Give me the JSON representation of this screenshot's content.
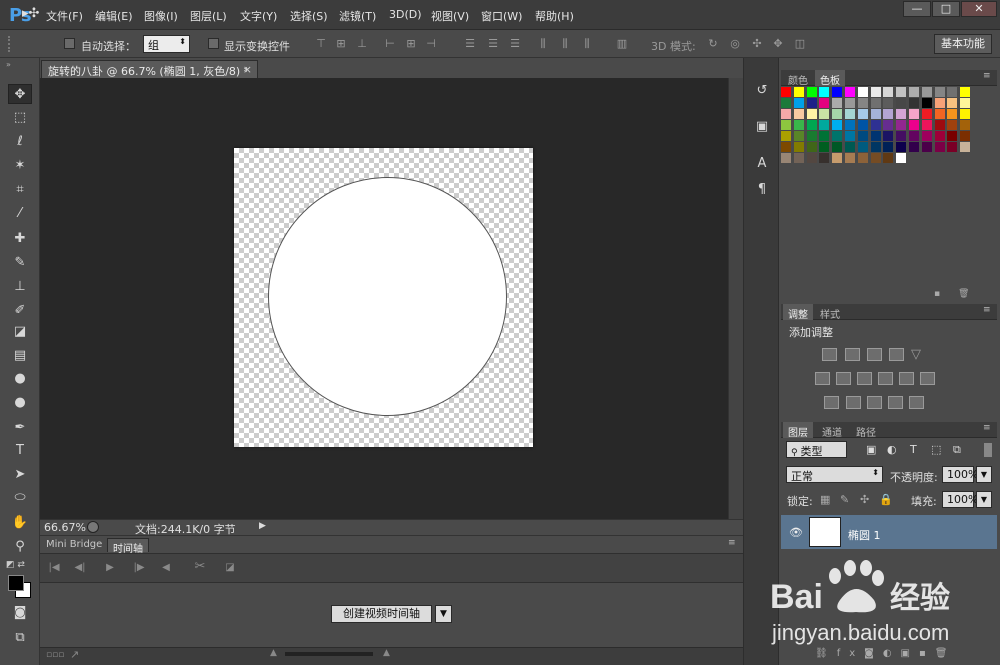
{
  "app": {
    "logo": "Ps",
    "menu": [
      "文件(F)",
      "编辑(E)",
      "图像(I)",
      "图层(L)",
      "文字(Y)",
      "选择(S)",
      "滤镜(T)",
      "3D(D)",
      "视图(V)",
      "窗口(W)",
      "帮助(H)"
    ],
    "window_controls": [
      "—",
      "□",
      "✕"
    ]
  },
  "options": {
    "tool_glyph": "▸✣",
    "auto_select_label": "自动选择：",
    "auto_select_value": "组",
    "transform_controls_label": "显示变换控件",
    "mode_3d_label": "3D 模式:",
    "workspace": "基本功能"
  },
  "document": {
    "tab_title": "旋转的八卦 @ 66.7% (椭圆 1, 灰色/8) *",
    "tab_close": "×",
    "zoom": "66.67%",
    "info": "文档:244.1K/0 字节"
  },
  "timeline": {
    "tabs": [
      "Mini Bridge",
      "时间轴"
    ],
    "create_button": "创建视频时间轴"
  },
  "panels": {
    "color_tabs": [
      "颜色",
      "色板"
    ],
    "adjust_tabs": [
      "调整",
      "样式"
    ],
    "adjust_title": "添加调整",
    "layers_tabs": [
      "图层",
      "通道",
      "路径"
    ],
    "filter_kind": "类型",
    "blend_mode": "正常",
    "opacity_label": "不透明度:",
    "opacity_value": "100%",
    "lock_label": "锁定:",
    "fill_label": "填充:",
    "fill_value": "100%",
    "layer_name": "椭圆 1"
  },
  "watermark": {
    "brand": "Bai",
    "brand_tail": "经验",
    "url": "jingyan.baidu.com"
  },
  "swatch_colors": [
    [
      "#ff0000",
      "#ffff00",
      "#00ff00",
      "#00ffff",
      "#0000ff",
      "#ff00ff",
      "#ffffff",
      "#ebebeb",
      "#d6d6d6",
      "#c2c2c2",
      "#adadad",
      "#999999",
      "#858585",
      "#707070",
      "#ffff00"
    ],
    [
      "#1b7a3a",
      "#00a0e9",
      "#1d2088",
      "#e4007f",
      "#ababab",
      "#999999",
      "#858585",
      "#707070",
      "#5c5c5c",
      "#474747",
      "#333333",
      "#000000",
      "#f7a278",
      "#f9c280",
      "#fff799"
    ],
    [
      "#f5a9a9",
      "#f8c9a1",
      "#fff3a5",
      "#c9e3a5",
      "#a5d5a9",
      "#a5d5d3",
      "#a5c9e9",
      "#a5b3d9",
      "#b3a5d3",
      "#d3a5d5",
      "#f5a5c9",
      "#ed1c24",
      "#f26522",
      "#f7941d",
      "#fff200"
    ],
    [
      "#8dc63f",
      "#39b54a",
      "#00a651",
      "#00a99d",
      "#00aeef",
      "#0072bc",
      "#0054a6",
      "#2e3192",
      "#662d91",
      "#92278f",
      "#ec008c",
      "#ed145b",
      "#9e0b0f",
      "#a0410d",
      "#a3620a"
    ],
    [
      "#aba000",
      "#598527",
      "#197b30",
      "#007236",
      "#00746b",
      "#0076a3",
      "#004a80",
      "#003471",
      "#1b1464",
      "#440e62",
      "#630460",
      "#9e005d",
      "#9e0039",
      "#790000",
      "#7b2e00"
    ],
    [
      "#7d4900",
      "#827b00",
      "#406618",
      "#005e20",
      "#005826",
      "#005952",
      "#005b7f",
      "#003663",
      "#002157",
      "#0d004c",
      "#32004b",
      "#4b0049",
      "#7b0046",
      "#7a0026",
      "#c7b299"
    ],
    [
      "#998675",
      "#736357",
      "#534741",
      "#37302d",
      "#c69c6d",
      "#a67c52",
      "#8c6239",
      "#754c24",
      "#603913",
      "#ffffff"
    ]
  ]
}
